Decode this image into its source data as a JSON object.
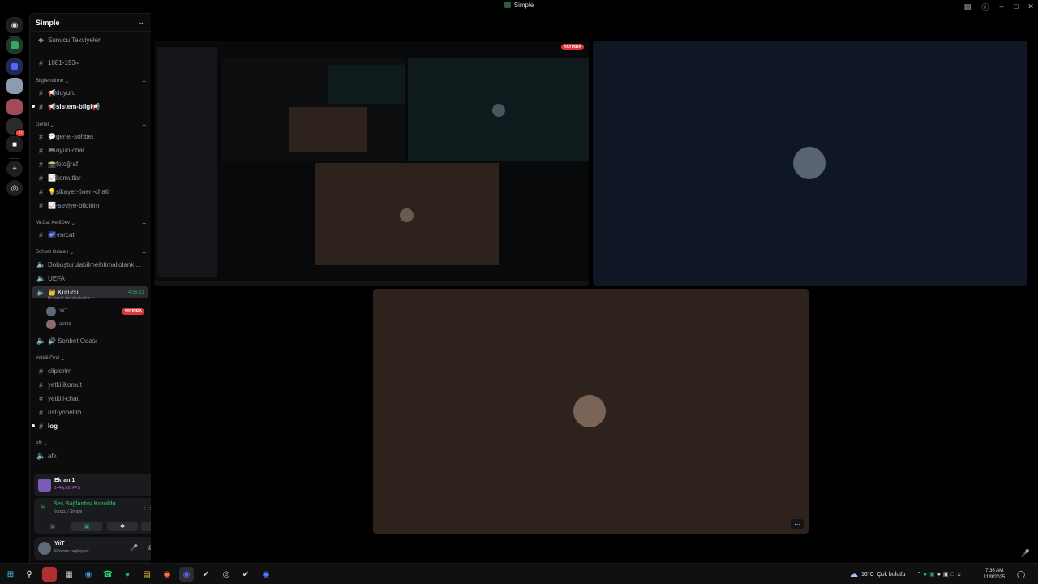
{
  "window": {
    "title": "Simple",
    "icons": [
      "inbox-icon",
      "help-icon"
    ],
    "controls": [
      "minimize",
      "maximize",
      "close"
    ]
  },
  "server": {
    "name": "Simple",
    "boosts_label": "Sunucu Takviyeleri"
  },
  "channels": {
    "top": "1881-193∞",
    "cat_bilgi": "Bilgilendirme",
    "duyuru": "📢duyuru",
    "sistem": "📢sistem-bilgi📢",
    "cat_genel": "Genel",
    "genel_sohbet": "💬genel-sohbet",
    "oyun_chat": "🎮oyun-chat",
    "fotograf": "📸fotoğraf",
    "komutlar": "📈komutlar",
    "sikayet": "💡şikayet-öneri-chati",
    "seviye": "📈-seviye-bildirim",
    "cat_mrcat": "Mr.Cat KediDev",
    "mrcat": "🌌-mrcat",
    "cat_sohbet": "Sohbet Odaları",
    "voice1": "Dobuşturulabilmeihtimaliolankı...",
    "voice2": "UEFA",
    "voice_active": "👑 Kurucu",
    "voice_active_timer": "4:56:21",
    "voice_status": "Bir kanal durumu belirle ✏",
    "member1": "YiiT",
    "member1_tag": "YAYINDA",
    "member2": "astrid",
    "voice3": "🔊 Sohbet Odası",
    "cat_yetkili": "Yetkili Özel",
    "cliplerim": "cliplerim",
    "yetkilikomut": "yetkilikomut",
    "yetkili_chat": "yetkili-chat",
    "ust_yonetim": "üst-yönetim",
    "log": "log",
    "cat_afk": "afk",
    "afk": "afk"
  },
  "screen_share": {
    "title": "Ekran 1",
    "quality": "1440p 60 FPS"
  },
  "voice_conn": {
    "status": "Ses Bağlantısı Kuruldu",
    "location": "Kurucu / Simple"
  },
  "user": {
    "name": "YiiT",
    "status": "Ekranını paylaşıyor"
  },
  "stage": {
    "live_tag": "YAYINDA",
    "more_label": "⋯"
  },
  "taskbar": {
    "weather_temp": "16°C",
    "weather_text": "Çok bulutlu",
    "time": "7:36 AM",
    "date": "11/9/2025"
  },
  "colors": {
    "accent_green": "#23a55a",
    "live_red": "#da373c",
    "brown_tile": "#2d221c",
    "navy_tile": "#0f1724",
    "teal_tile": "#0f1a1c"
  }
}
